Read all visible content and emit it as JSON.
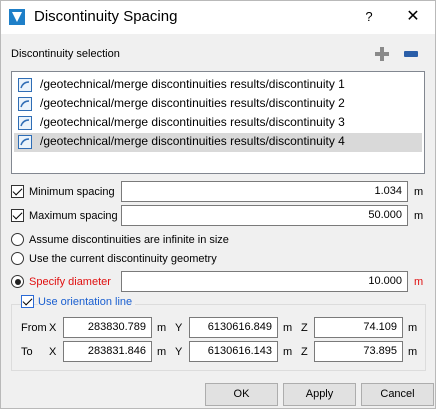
{
  "window": {
    "title": "Discontinuity Spacing",
    "help_label": "?",
    "close_label": "✕"
  },
  "selection": {
    "label": "Discontinuity selection",
    "items": [
      "/geotechnical/merge discontinuities results/discontinuity 1",
      "/geotechnical/merge discontinuities results/discontinuity 2",
      "/geotechnical/merge discontinuities results/discontinuity 3",
      "/geotechnical/merge discontinuities results/discontinuity 4"
    ]
  },
  "minimum_spacing": {
    "label": "Minimum spacing",
    "value": "1.034",
    "unit": "m"
  },
  "maximum_spacing": {
    "label": "Maximum spacing",
    "value": "50.000",
    "unit": "m"
  },
  "options": {
    "infinite_label": "Assume discontinuities are infinite in size",
    "current_geometry_label": "Use the current discontinuity geometry",
    "specify_diameter_label": "Specify diameter",
    "diameter_value": "10.000",
    "diameter_unit": "m"
  },
  "orientation": {
    "label": "Use orientation line",
    "from_label": "From",
    "to_label": "To",
    "x_label": "X",
    "y_label": "Y",
    "z_label": "Z",
    "unit": "m",
    "from": {
      "x": "283830.789",
      "y": "6130616.849",
      "z": "74.109"
    },
    "to": {
      "x": "283831.846",
      "y": "6130616.143",
      "z": "73.895"
    }
  },
  "buttons": {
    "ok": "OK",
    "apply": "Apply",
    "cancel": "Cancel"
  },
  "colors": {
    "required_red": "#e01010",
    "link_blue": "#1a5fd0",
    "selection_gray": "#d9d9d9"
  }
}
